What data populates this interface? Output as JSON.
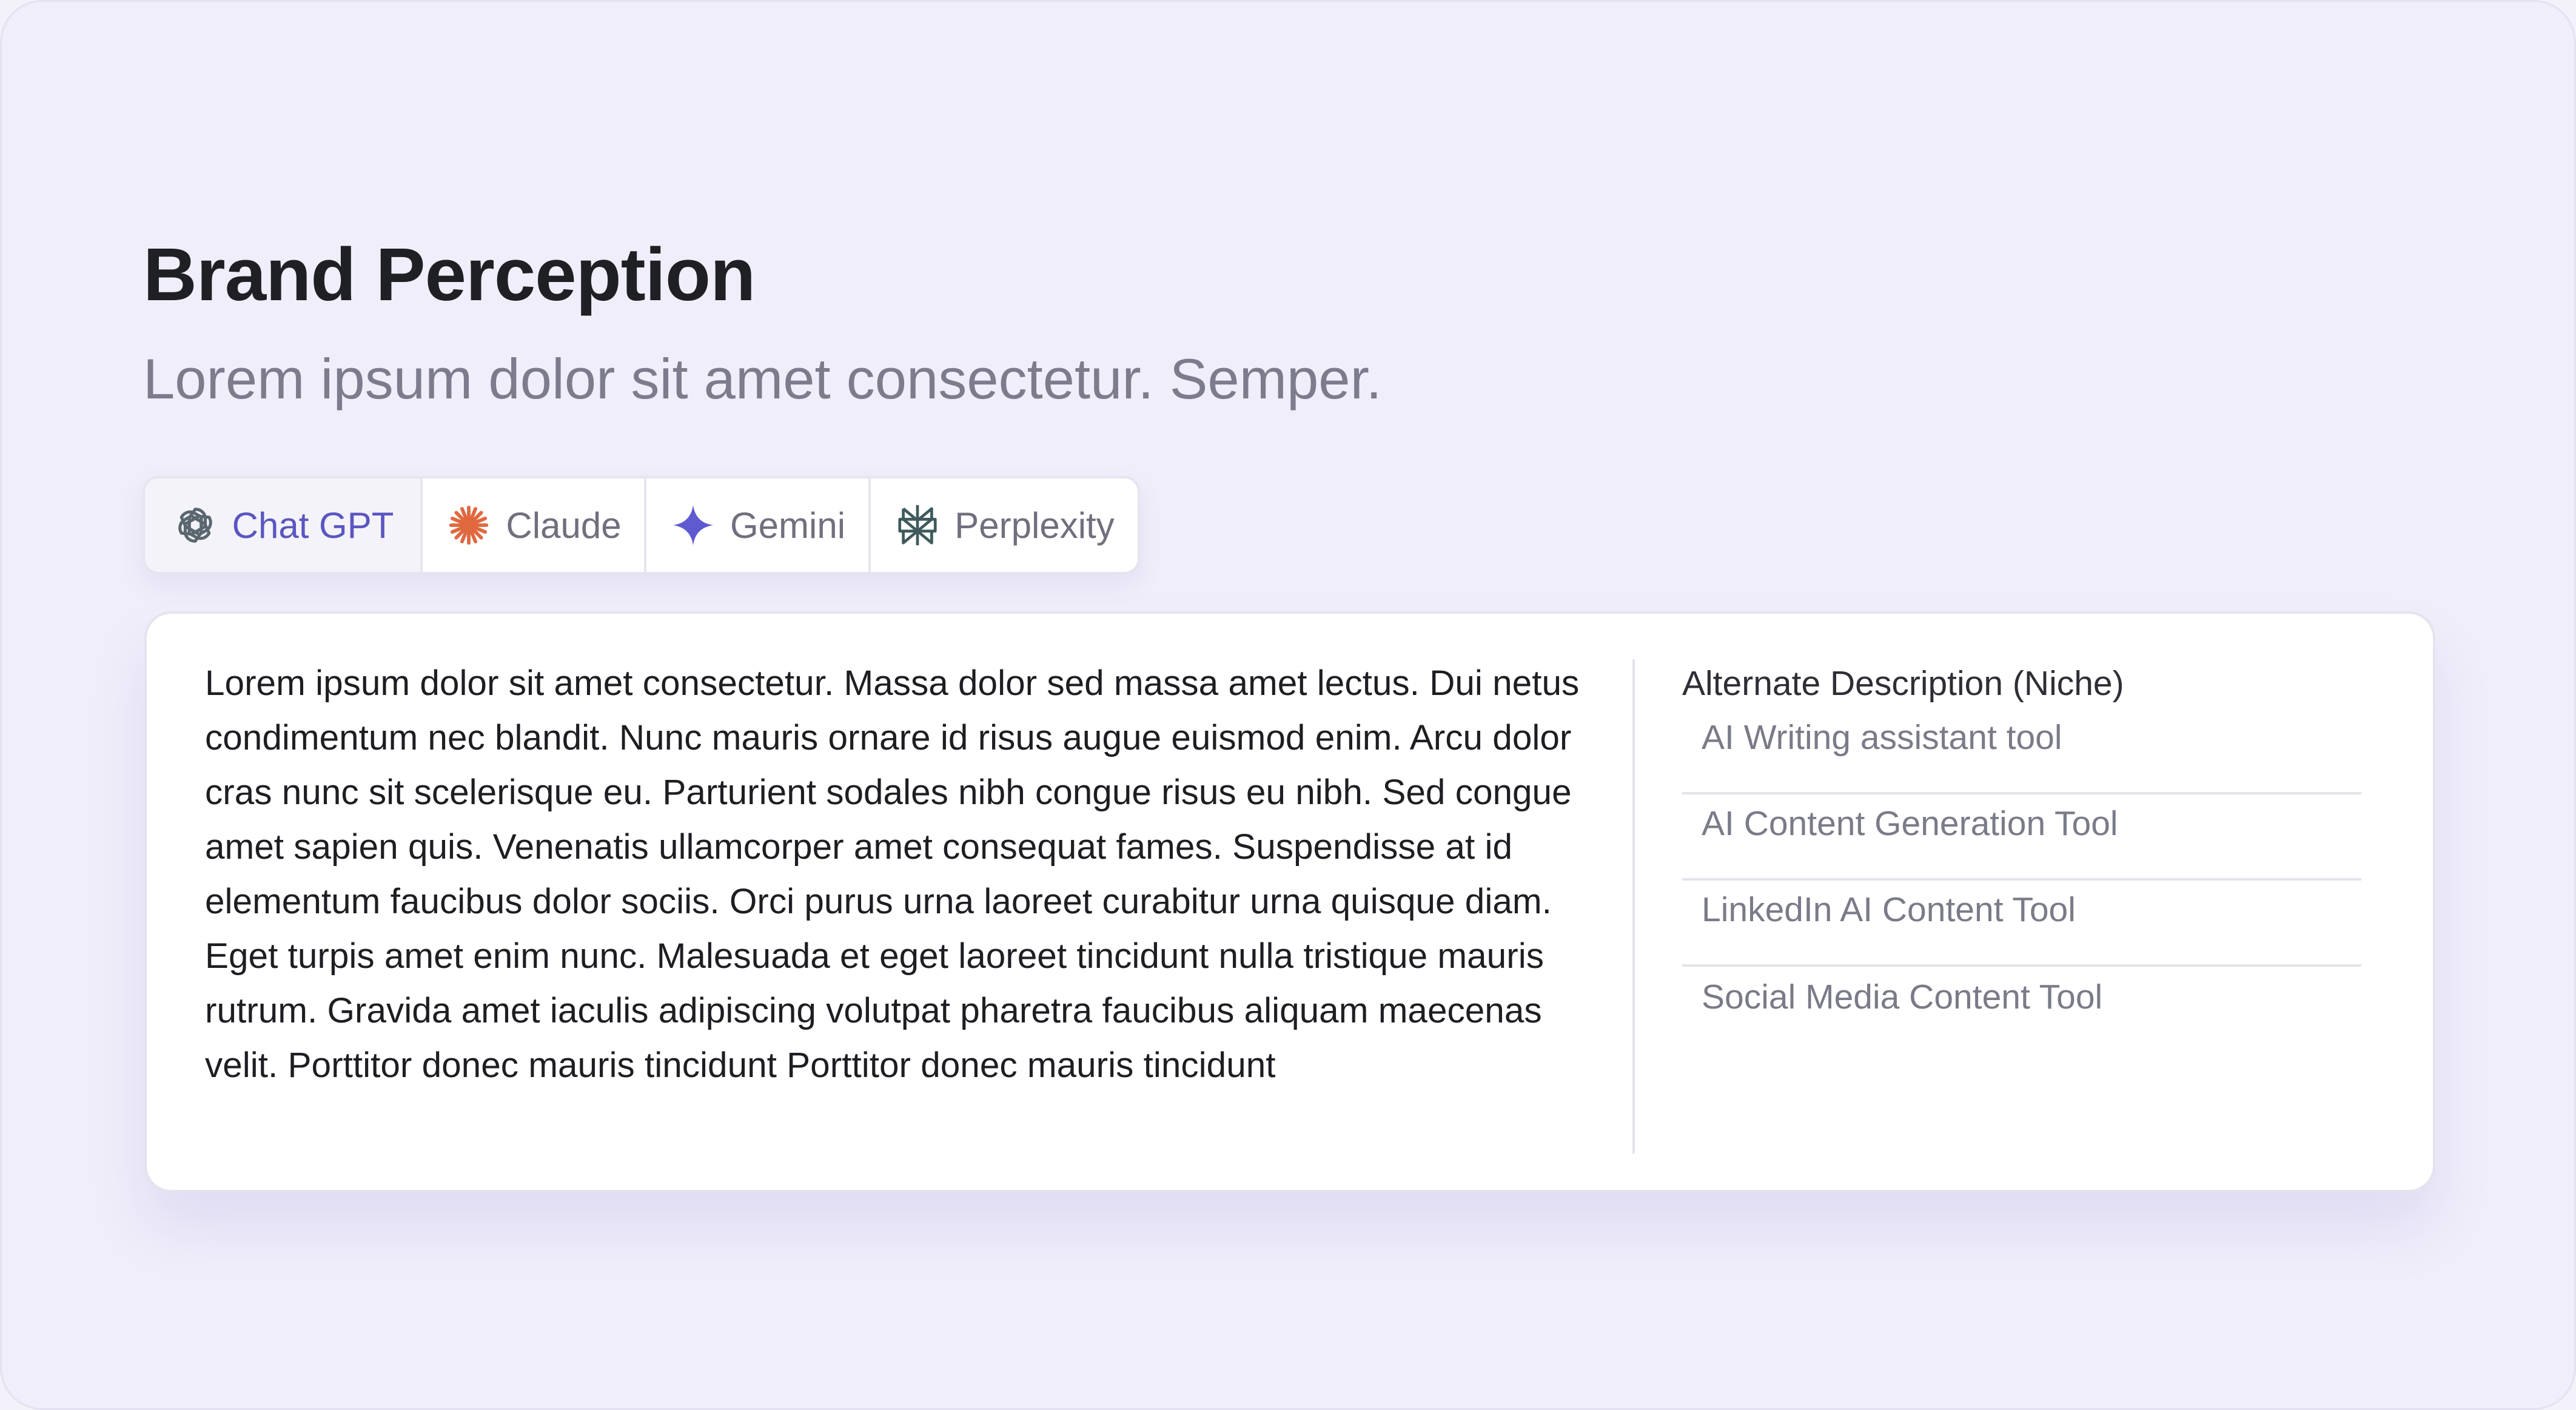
{
  "header": {
    "title": "Brand Perception",
    "subtitle": "Lorem ipsum dolor sit amet consectetur. Semper."
  },
  "tabs": [
    {
      "label": "Chat GPT",
      "icon": "openai-icon",
      "active": true
    },
    {
      "label": "Claude",
      "icon": "claude-icon",
      "active": false
    },
    {
      "label": "Gemini",
      "icon": "gemini-icon",
      "active": false
    },
    {
      "label": "Perplexity",
      "icon": "perplexity-icon",
      "active": false
    }
  ],
  "content": {
    "description": "Lorem ipsum dolor sit amet consectetur. Massa dolor sed massa amet lectus. Dui netus condimentum nec blandit. Nunc mauris ornare id risus augue euismod enim. Arcu dolor cras nunc sit scelerisque eu. Parturient sodales nibh congue risus eu nibh. Sed congue amet sapien quis. Venenatis ullamcorper amet consequat fames. Suspendisse at id elementum faucibus dolor sociis. Orci purus urna laoreet curabitur urna quisque diam. Eget turpis amet enim nunc. Malesuada et eget laoreet tincidunt nulla tristique mauris rutrum. Gravida amet iaculis adipiscing volutpat pharetra faucibus aliquam maecenas velit. Porttitor donec mauris tincidunt  Porttitor donec mauris tincidunt"
  },
  "alternate": {
    "heading": "Alternate Description (Niche)",
    "items": [
      "AI Writing assistant tool",
      "AI Content Generation Tool",
      "LinkedIn AI Content Tool",
      "Social Media Content Tool"
    ]
  },
  "colors": {
    "background": "#f0eefa",
    "accent": "#5a56c0",
    "claude_orange": "#e0683f",
    "gemini_purple": "#5e5ad0",
    "text_dark": "#1f2024",
    "text_muted": "#7a7b88"
  }
}
